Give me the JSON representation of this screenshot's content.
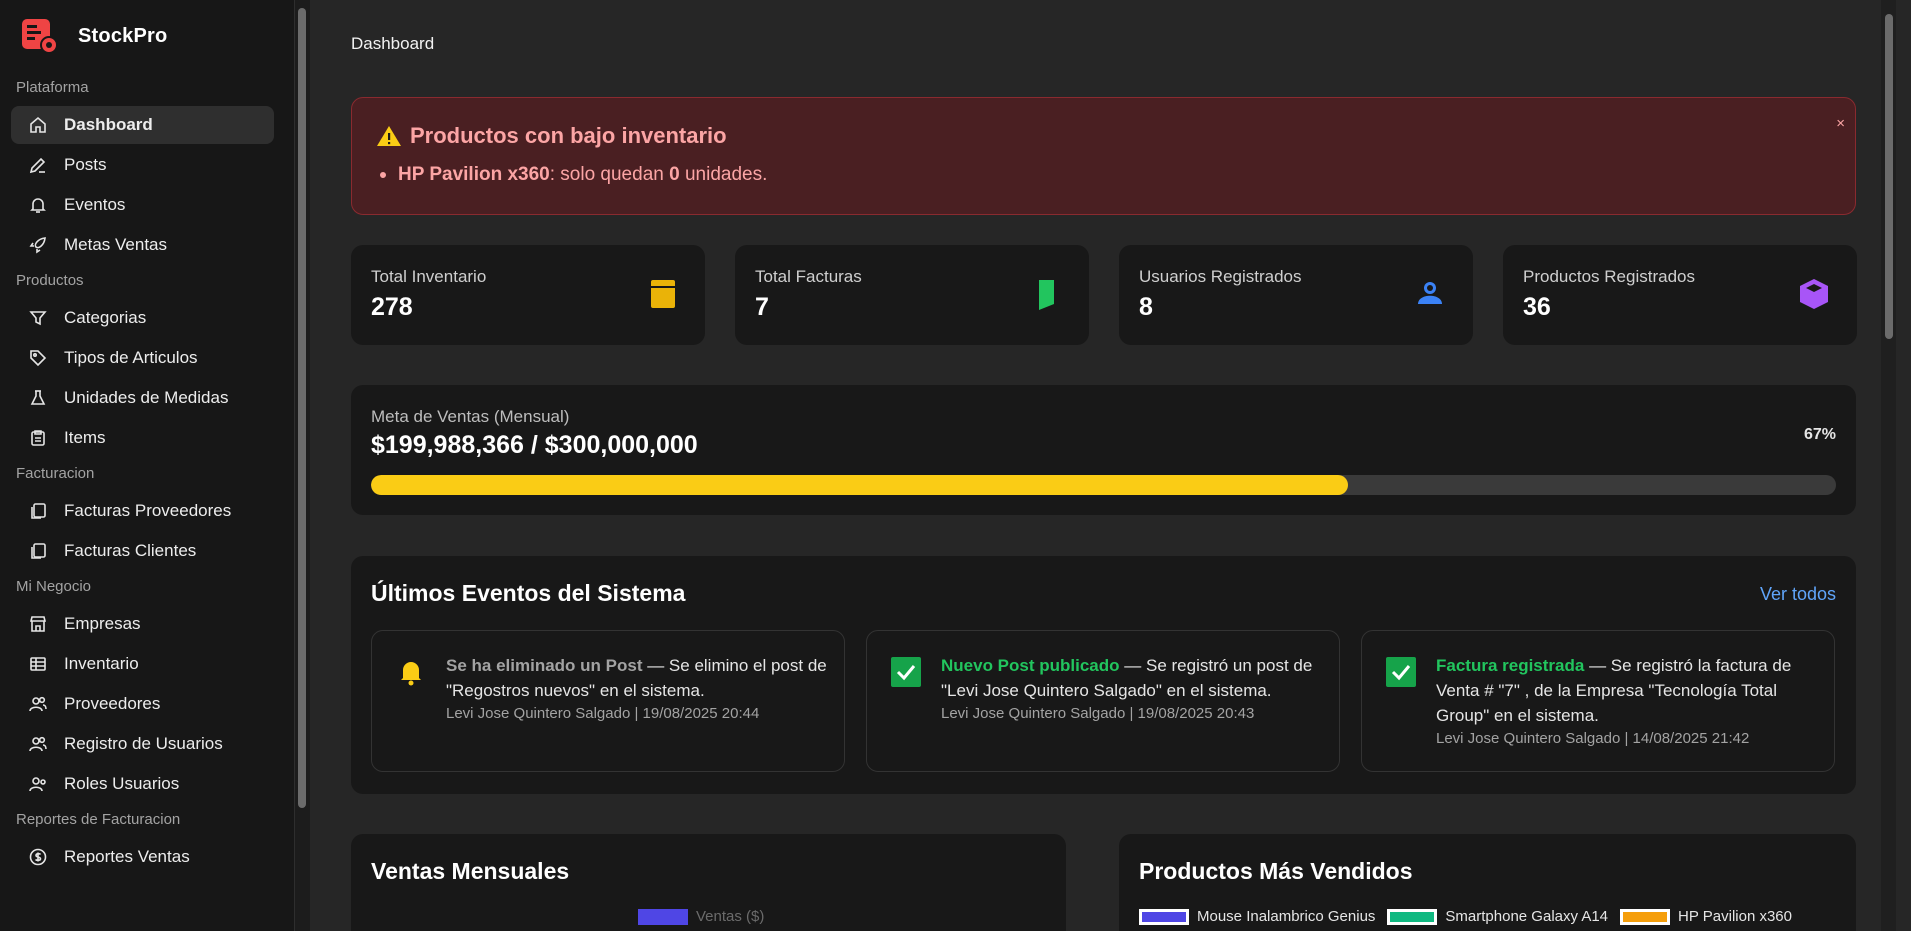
{
  "app": {
    "name": "StockPro"
  },
  "sidebar": {
    "groups": [
      {
        "label": "Plataforma",
        "items": [
          {
            "label": "Dashboard",
            "icon": "home-icon",
            "active": true
          },
          {
            "label": "Posts",
            "icon": "pencil-icon"
          },
          {
            "label": "Eventos",
            "icon": "bell-icon"
          },
          {
            "label": "Metas Ventas",
            "icon": "rocket-icon"
          }
        ]
      },
      {
        "label": "Productos",
        "items": [
          {
            "label": "Categorias",
            "icon": "filter-icon"
          },
          {
            "label": "Tipos de Articulos",
            "icon": "tag-icon"
          },
          {
            "label": "Unidades de Medidas",
            "icon": "flask-icon"
          },
          {
            "label": "Items",
            "icon": "clipboard-icon"
          }
        ]
      },
      {
        "label": "Facturacion",
        "items": [
          {
            "label": "Facturas Proveedores",
            "icon": "copy-icon"
          },
          {
            "label": "Facturas Clientes",
            "icon": "copy-icon"
          }
        ]
      },
      {
        "label": "Mi Negocio",
        "items": [
          {
            "label": "Empresas",
            "icon": "store-icon"
          },
          {
            "label": "Inventario",
            "icon": "table-icon"
          },
          {
            "label": "Proveedores",
            "icon": "users-icon"
          },
          {
            "label": "Registro de Usuarios",
            "icon": "users-icon"
          },
          {
            "label": "Roles Usuarios",
            "icon": "user-group-icon"
          }
        ]
      },
      {
        "label": "Reportes de Facturacion",
        "items": [
          {
            "label": "Reportes Ventas",
            "icon": "dollar-circle-icon"
          }
        ]
      }
    ]
  },
  "breadcrumb": "Dashboard",
  "alert": {
    "title": "Productos con bajo inventario",
    "close": "×",
    "product": "HP Pavilion x360",
    "text_before": ": solo quedan ",
    "count": "0",
    "text_after": " unidades."
  },
  "stats": [
    {
      "label": "Total Inventario",
      "value": "278",
      "icon": "book-icon",
      "color": "#eab308"
    },
    {
      "label": "Total Facturas",
      "value": "7",
      "icon": "bookmark-icon",
      "color": "#22c55e"
    },
    {
      "label": "Usuarios Registrados",
      "value": "8",
      "icon": "user-icon",
      "color": "#3b82f6"
    },
    {
      "label": "Productos Registrados",
      "value": "36",
      "icon": "cube-icon",
      "color": "#a855f7"
    }
  ],
  "goal": {
    "label": "Meta de Ventas (Mensual)",
    "value": "$199,988,366 / $300,000,000",
    "percent_text": "67%",
    "progress": 0.667,
    "color": "#facc15"
  },
  "events": {
    "title": "Últimos Eventos del Sistema",
    "link": "Ver todos",
    "items": [
      {
        "icon": "bell-icon",
        "title": "Se ha eliminado un Post",
        "title_color": "#a3a3a3",
        "desc": " — Se elimino el post de \"Regostros nuevos\" en el sistema.",
        "meta": "Levi Jose Quintero Salgado | 19/08/2025 20:44"
      },
      {
        "icon": "check-icon",
        "title": "Nuevo Post publicado",
        "title_color": "#22c55e",
        "desc": " — Se registró un post de \"Levi Jose Quintero Salgado\" en el sistema.",
        "meta": "Levi Jose Quintero Salgado | 19/08/2025 20:43"
      },
      {
        "icon": "check-icon",
        "title": "Factura registrada",
        "title_color": "#22c55e",
        "desc": " — Se registró la factura de Venta # \"7\" , de la Empresa \"Tecnología Total Group\" en el sistema.",
        "meta": "Levi Jose Quintero Salgado | 14/08/2025 21:42"
      }
    ]
  },
  "ventas": {
    "title": "Ventas Mensuales",
    "legend": [
      {
        "label": "Ventas ($)",
        "color": "#4f46e5"
      }
    ]
  },
  "productos": {
    "title": "Productos Más Vendidos",
    "legend": [
      {
        "label": "Mouse Inalambrico Genius",
        "color": "#4f46e5"
      },
      {
        "label": "Smartphone Galaxy A14",
        "color": "#10b981"
      },
      {
        "label": "HP Pavilion x360",
        "color": "#f59e0b"
      }
    ]
  }
}
